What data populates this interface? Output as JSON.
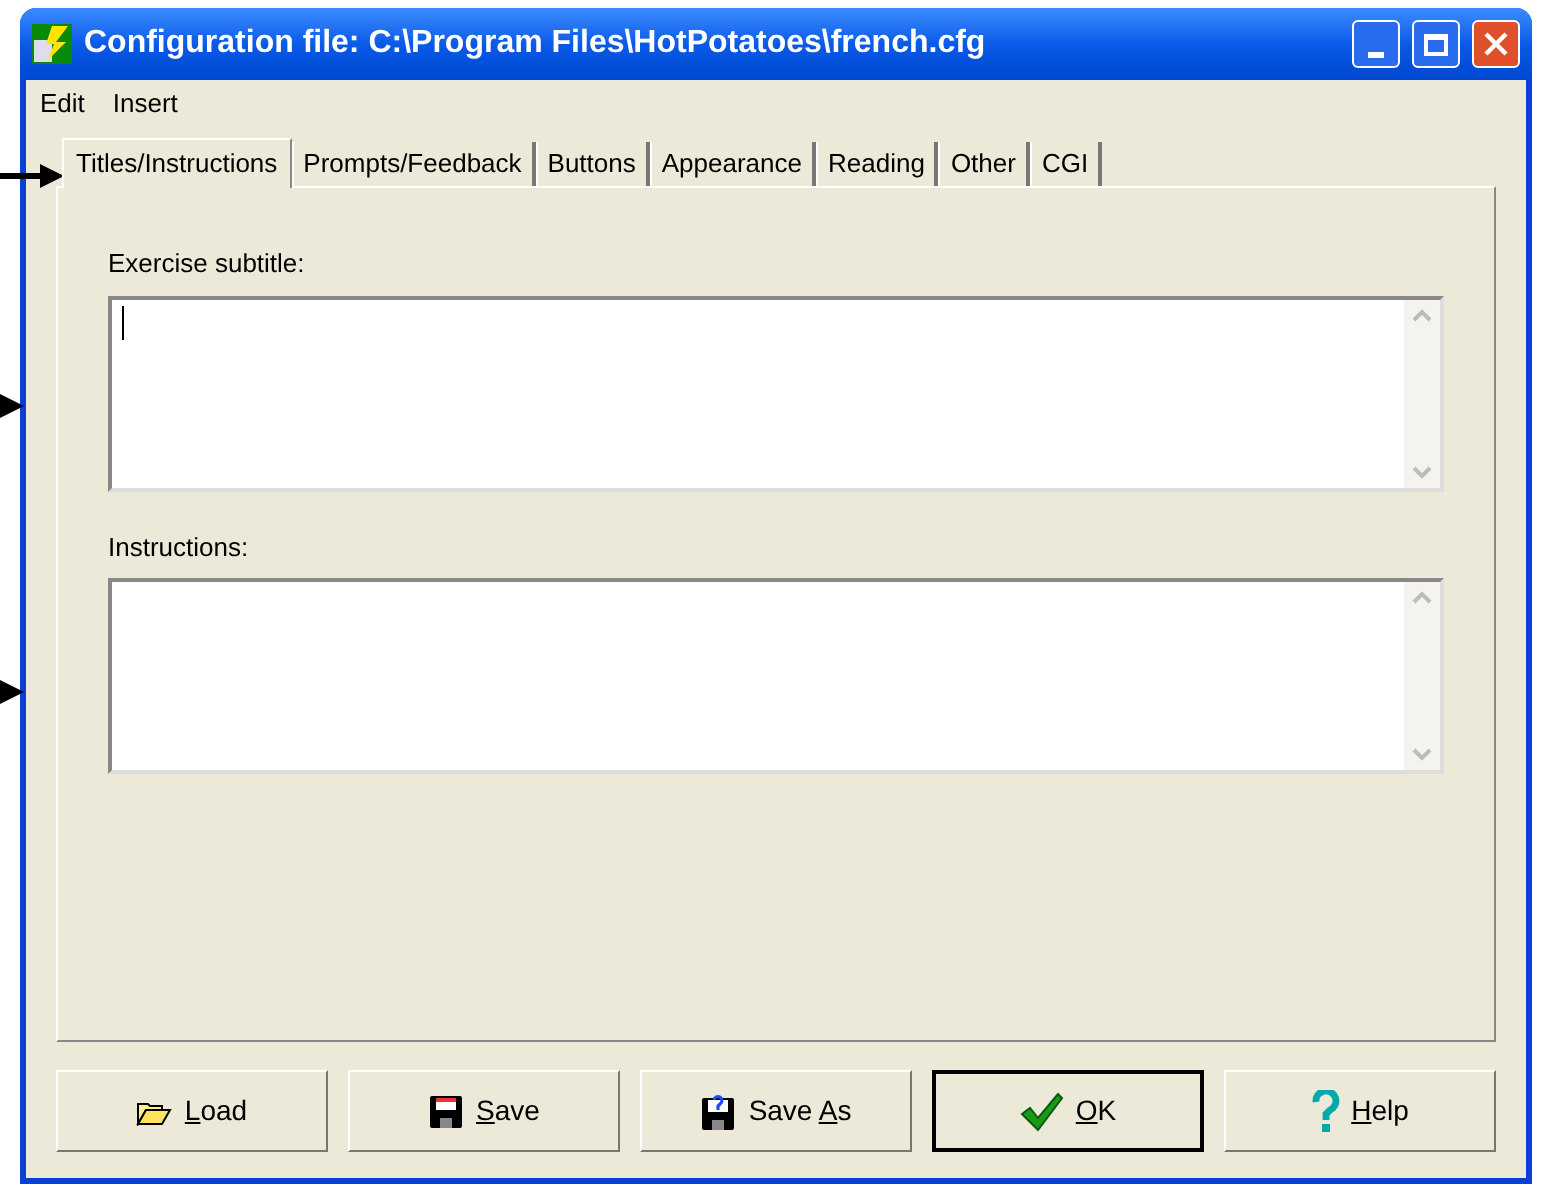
{
  "window": {
    "title": "Configuration file: C:\\Program Files\\HotPotatoes\\french.cfg"
  },
  "menu": [
    "Edit",
    "Insert"
  ],
  "tabs": [
    {
      "label": "Titles/Instructions",
      "selected": true
    },
    {
      "label": "Prompts/Feedback",
      "selected": false
    },
    {
      "label": "Buttons",
      "selected": false
    },
    {
      "label": "Appearance",
      "selected": false
    },
    {
      "label": "Reading",
      "selected": false
    },
    {
      "label": "Other",
      "selected": false
    },
    {
      "label": "CGI",
      "selected": false
    }
  ],
  "fields": [
    {
      "label": "Exercise subtitle:",
      "focused": true
    },
    {
      "label": "Instructions:",
      "focused": false
    }
  ],
  "buttons": [
    {
      "kind": "load",
      "key": "L",
      "after": "oad",
      "default": false
    },
    {
      "kind": "save",
      "key": "S",
      "after": "ave",
      "default": false
    },
    {
      "kind": "saveas",
      "before": "Save ",
      "key": "A",
      "after": "s",
      "default": false
    },
    {
      "kind": "ok",
      "key": "O",
      "after": "K",
      "default": true
    },
    {
      "kind": "help",
      "key": "H",
      "after": "elp",
      "default": false
    }
  ]
}
